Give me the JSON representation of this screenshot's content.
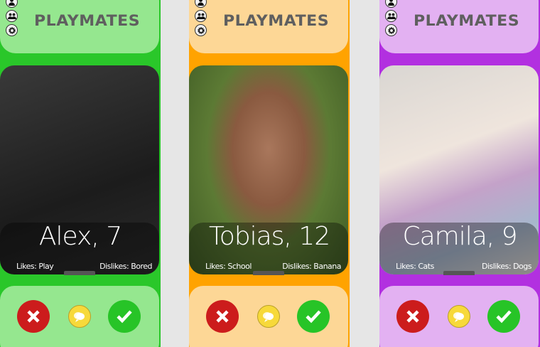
{
  "app_title": "PLAYMATES",
  "icons": [
    "profile-icon",
    "group-icon",
    "gear-icon"
  ],
  "colors": {
    "reject": "#cc1c1c",
    "chat": "#f7d93a",
    "accept": "#27c427"
  },
  "panels": [
    {
      "theme": {
        "bg": "#2ac72a",
        "light": "#95e78f"
      },
      "name": "Alex, 7",
      "likes": "Likes: Play",
      "dislikes": "Dislikes: Bored",
      "photo": "linear-gradient(160deg,#3a3a3a,#1c1c1c 60%,#2b2b2b)"
    },
    {
      "theme": {
        "bg": "#ffa300",
        "light": "#fdd796"
      },
      "name": "Tobias, 12",
      "likes": "Likes: School",
      "dislikes": "Dislikes: Banana",
      "photo": "radial-gradient(ellipse at 50% 40%,#a9775c 0,#8a5a40 32%,#5c7a34 55%,#3e5a24 100%)"
    },
    {
      "theme": {
        "bg": "#b230e0",
        "light": "#e3b1f2"
      },
      "name": "Camila, 9",
      "likes": "Likes: Cats",
      "dislikes": "Dislikes: Dogs",
      "photo": "linear-gradient(160deg,#d9d6d2,#efe5dd 40%,#c4a2c9 60%,#a7b6cc 80%,#dcd6d0)"
    }
  ]
}
